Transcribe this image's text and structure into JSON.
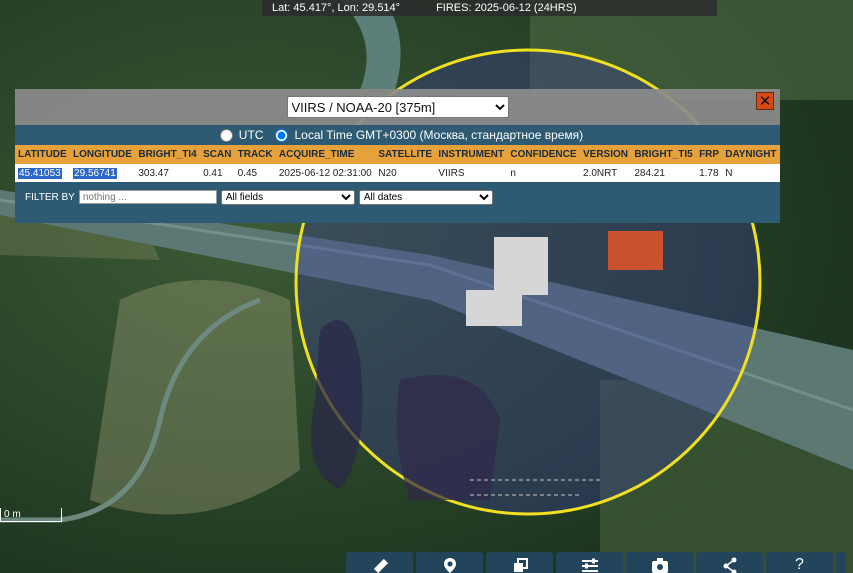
{
  "status": {
    "coords": "Lat: 45.417°, Lon: 29.514°",
    "fires": "FIRES: 2025-06-12 (24HRS)"
  },
  "dialog": {
    "product": "VIIRS / NOAA-20 [375m]",
    "close_label": "✕",
    "time_options": {
      "utc": "UTC",
      "local": "Local Time GMT+0300 (Москва, стандартное время)"
    },
    "columns": [
      "LATITUDE",
      "LONGITUDE",
      "BRIGHT_TI4",
      "SCAN",
      "TRACK",
      "ACQUIRE_TIME",
      "SATELLITE",
      "INSTRUMENT",
      "CONFIDENCE",
      "VERSION",
      "BRIGHT_TI5",
      "FRP",
      "DAYNIGHT"
    ],
    "row": [
      "45.41053",
      "29.56741",
      "303.47",
      "0.41",
      "0.45",
      "2025-06-12 02:31:00",
      "N20",
      "VIIRS",
      "n",
      "2.0NRT",
      "284.21",
      "1.78",
      "N"
    ],
    "filter": {
      "label": "FILTER BY",
      "placeholder": "nothing ...",
      "fields_option": "All fields",
      "dates_option": "All dates"
    }
  },
  "scale_label": "0 m",
  "toolbar_icons": [
    "ruler-icon",
    "location-pin-icon",
    "layers-icon",
    "sliders-icon",
    "camera-icon",
    "share-icon",
    "help-icon",
    "extra-icon"
  ],
  "toolbar_labels": {
    "help": "?"
  },
  "colors": {
    "fire_pixel": "#c8532e",
    "circle": "#f0e020",
    "header": "#e7a13a",
    "panel": "#2e5a74"
  }
}
